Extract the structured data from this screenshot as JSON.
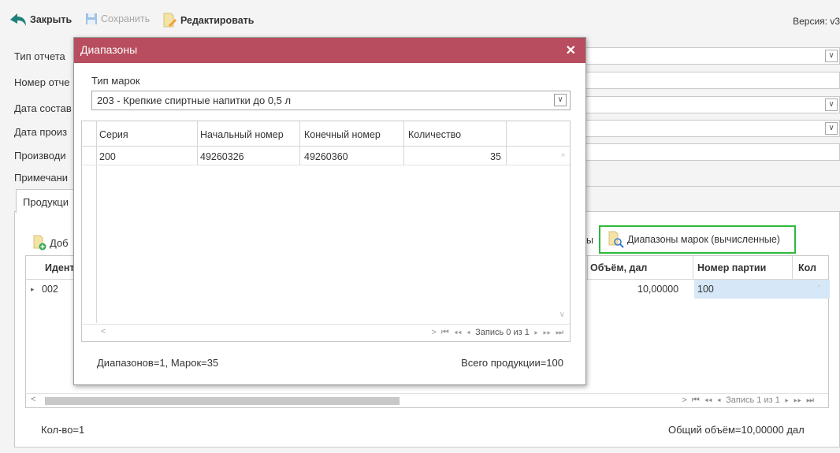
{
  "toolbar": {
    "close_label": "Закрыть",
    "save_label": "Сохранить",
    "edit_label": "Редактировать",
    "version_label": "Версия: v3"
  },
  "form": {
    "labels": [
      "Тип отчета",
      "Номер отче",
      "Дата состав",
      "Дата произ",
      "Производи",
      "Примечани"
    ]
  },
  "tab_label": "Продукци",
  "add_label": "Доб",
  "ranges_button_prefix": "ы",
  "ranges_button_label": "Диапазоны марок (вычисленные)",
  "grid": {
    "headers": [
      "Идент",
      "Объём, дал",
      "Номер партии",
      "Кол"
    ],
    "row": {
      "id": "002",
      "volume": "10,00000",
      "batch": "100"
    },
    "pager": "Запись 1 из 1"
  },
  "footer": {
    "count": "Кол-во=1",
    "total_volume": "Общий объём=10,00000 дал"
  },
  "modal": {
    "title": "Диапазоны",
    "stamp_type_label": "Тип марок",
    "stamp_type_value": "203 - Крепкие спиртные напитки до 0,5 л",
    "headers": [
      "Серия",
      "Начальный номер",
      "Конечный номер",
      "Количество"
    ],
    "rows": [
      {
        "series": "200",
        "start": "49260326",
        "end": "49260360",
        "qty": "35"
      }
    ],
    "pager": "Запись 0 из 1",
    "summary_left": "Диапазонов=1, Марок=35",
    "summary_right": "Всего продукции=100"
  },
  "colors": {
    "modal_title_bg": "#b74d5e",
    "highlight_border": "#2dba3b",
    "close_arrow": "#1f7f7b"
  }
}
